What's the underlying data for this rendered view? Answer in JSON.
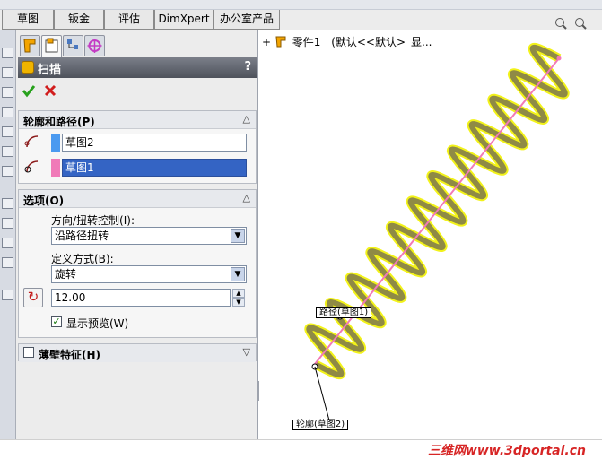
{
  "toolbar_tabs": [
    "草图",
    "钣金",
    "评估",
    "DimXpert",
    "办公室产品"
  ],
  "property_manager": {
    "title": "扫描",
    "help": "?",
    "ok_icon": "check-icon",
    "cancel_icon": "close-icon",
    "profile_path": {
      "title": "轮廓和路径(P)",
      "path_value": "草图2",
      "profile_value": "草图1",
      "path_color": "#4b9af0",
      "profile_color": "#f07ab8"
    },
    "options": {
      "title": "选项(O)",
      "orientation_label": "方向/扭转控制(I):",
      "orientation_value": "沿路径扭转",
      "define_label": "定义方式(B):",
      "define_value": "旋转",
      "twist_value": "12.00",
      "preview_label": "显示预览(W)",
      "preview_checked": true
    },
    "thin_feature": {
      "title": "薄壁特征(H)",
      "checked": false
    }
  },
  "feature_tree": {
    "part_label": "零件1",
    "config_label": "(默认<<默认>_显..."
  },
  "callouts": {
    "path": "路径(草图1)",
    "profile": "轮廓(草图2)"
  },
  "watermark": "三维网www.3dportal.cn",
  "colors": {
    "coil": "#8f8a45",
    "highlight": "#f2f21a",
    "path_line": "#f27ab6"
  }
}
